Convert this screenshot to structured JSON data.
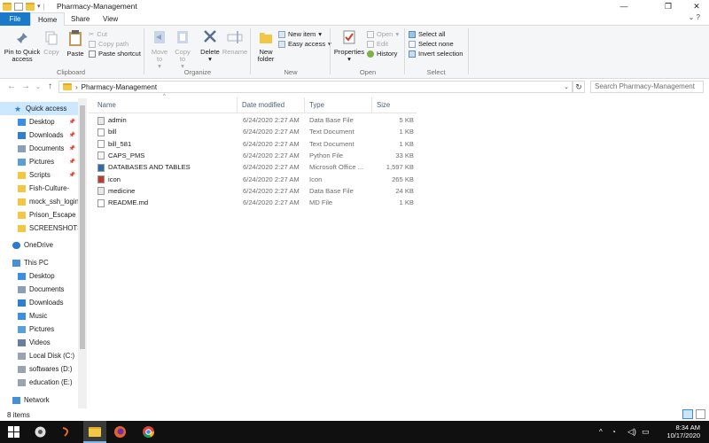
{
  "window": {
    "title": "Pharmacy-Management",
    "minimize": "—",
    "restore": "❐",
    "close": "✕"
  },
  "tabs": [
    "File",
    "Home",
    "Share",
    "View"
  ],
  "ribbon": {
    "clipboard": {
      "label": "Clipboard",
      "pin": "Pin to Quick access",
      "copy": "Copy",
      "paste": "Paste",
      "cut": "Cut",
      "copy_path": "Copy path",
      "paste_shortcut": "Paste shortcut"
    },
    "organize": {
      "label": "Organize",
      "move_to": "Move to",
      "copy_to": "Copy to",
      "delete": "Delete",
      "rename": "Rename"
    },
    "new": {
      "label": "New",
      "new_folder": "New folder",
      "new_item": "New item",
      "easy_access": "Easy access"
    },
    "open": {
      "label": "Open",
      "properties": "Properties",
      "open": "Open",
      "edit": "Edit",
      "history": "History"
    },
    "select": {
      "label": "Select",
      "select_all": "Select all",
      "select_none": "Select none",
      "invert": "Invert selection"
    }
  },
  "address": {
    "path": "Pharmacy-Management",
    "search_placeholder": "Search Pharmacy-Management"
  },
  "nav": {
    "quick_access": "Quick access",
    "quick_items": [
      "Desktop",
      "Downloads",
      "Documents",
      "Pictures",
      "Scripts",
      "Fish-Culture-",
      "mock_ssh_login",
      "Prison_Escape",
      "SCREENSHOTS"
    ],
    "onedrive": "OneDrive",
    "this_pc": "This PC",
    "pc_items": [
      "Desktop",
      "Documents",
      "Downloads",
      "Music",
      "Pictures",
      "Videos",
      "Local Disk (C:)",
      "softwares (D:)",
      "education (E:)"
    ],
    "network": "Network"
  },
  "columns": {
    "name": "Name",
    "date": "Date modified",
    "type": "Type",
    "size": "Size"
  },
  "files": [
    {
      "name": "admin",
      "date": "6/24/2020 2:27 AM",
      "type": "Data Base File",
      "size": "5 KB",
      "icon": "db-file-icon"
    },
    {
      "name": "bill",
      "date": "6/24/2020 2:27 AM",
      "type": "Text Document",
      "size": "1 KB",
      "icon": "text-file-icon"
    },
    {
      "name": "bill_581",
      "date": "6/24/2020 2:27 AM",
      "type": "Text Document",
      "size": "1 KB",
      "icon": "text-file-icon"
    },
    {
      "name": "CAPS_PMS",
      "date": "6/24/2020 2:27 AM",
      "type": "Python File",
      "size": "33 KB",
      "icon": "python-file-icon"
    },
    {
      "name": "DATABASES AND TABLES",
      "date": "6/24/2020 2:27 AM",
      "type": "Microsoft Office ...",
      "size": "1,597 KB",
      "icon": "office-file-icon"
    },
    {
      "name": "icon",
      "date": "6/24/2020 2:27 AM",
      "type": "Icon",
      "size": "265 KB",
      "icon": "ico-file-icon"
    },
    {
      "name": "medicine",
      "date": "6/24/2020 2:27 AM",
      "type": "Data Base File",
      "size": "24 KB",
      "icon": "db-file-icon"
    },
    {
      "name": "README.md",
      "date": "6/24/2020 2:27 AM",
      "type": "MD File",
      "size": "1 KB",
      "icon": "md-file-icon"
    }
  ],
  "status": {
    "items": "8 items"
  },
  "clock": {
    "time": "8:34 AM",
    "date": "10/17/2020"
  }
}
